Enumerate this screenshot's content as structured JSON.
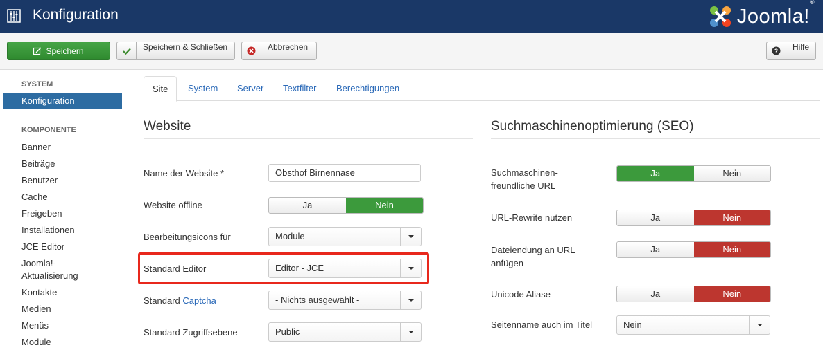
{
  "header": {
    "title": "Konfiguration",
    "logo_text": "Joomla!",
    "logo_reg": "®"
  },
  "toolbar": {
    "save": "Speichern",
    "save_close": "Speichern & Schließen",
    "cancel": "Abbrechen",
    "help": "Hilfe"
  },
  "sidebar": {
    "system_head": "SYSTEM",
    "active": "Konfiguration",
    "components_head": "KOMPONENTE",
    "items": [
      "Banner",
      "Beiträge",
      "Benutzer",
      "Cache",
      "Freigeben",
      "Installationen",
      "JCE Editor",
      "Joomla!-",
      "Aktualisierung",
      "Kontakte",
      "Medien",
      "Menüs",
      "Module"
    ]
  },
  "tabs": [
    "Site",
    "System",
    "Server",
    "Textfilter",
    "Berechtigungen"
  ],
  "website": {
    "title": "Website",
    "site_name_label": "Name der Website *",
    "site_name_value": "Obsthof Birnennase",
    "offline_label": "Website offline",
    "offline_yes": "Ja",
    "offline_no": "Nein",
    "edit_icons_label": "Bearbeitungsicons für",
    "edit_icons_value": "Module",
    "editor_label": "Standard Editor",
    "editor_value": "Editor - JCE",
    "captcha_label_prefix": "Standard",
    "captcha_label_link": "Captcha",
    "captcha_value": "- Nichts ausgewählt -",
    "access_label": "Standard Zugriffsebene",
    "access_value": "Public"
  },
  "seo": {
    "title": "Suchmaschinenoptimierung (SEO)",
    "sef_label_1": "Suchmaschinen-",
    "sef_label_2": "freundliche URL",
    "rewrite_label": "URL-Rewrite nutzen",
    "suffix_label_1": "Dateiendung an URL",
    "suffix_label_2": "anfügen",
    "unicode_label": "Unicode Aliase",
    "sitename_label": "Seitenname auch im Titel",
    "sitename_value": "Nein",
    "yes": "Ja",
    "no": "Nein"
  },
  "colors": {
    "header": "#1a3867",
    "active": "#2d6ca2",
    "green": "#3c9a3c",
    "red": "#bd362f",
    "highlight": "#e8281c"
  }
}
